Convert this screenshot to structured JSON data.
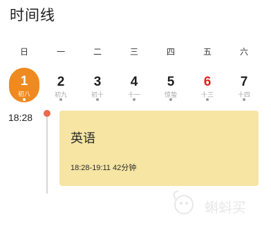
{
  "header": {
    "title": "时间线"
  },
  "weekdays": [
    "日",
    "一",
    "二",
    "三",
    "四",
    "五",
    "六"
  ],
  "days": [
    {
      "num": "1",
      "lunar": "初八",
      "selected": true,
      "red": false
    },
    {
      "num": "2",
      "lunar": "初九",
      "selected": false,
      "red": false
    },
    {
      "num": "3",
      "lunar": "初十",
      "selected": false,
      "red": false
    },
    {
      "num": "4",
      "lunar": "十一",
      "selected": false,
      "red": false
    },
    {
      "num": "5",
      "lunar": "惊蛰",
      "selected": false,
      "red": false
    },
    {
      "num": "6",
      "lunar": "十三",
      "selected": false,
      "red": true
    },
    {
      "num": "7",
      "lunar": "十四",
      "selected": false,
      "red": false
    }
  ],
  "timeline": {
    "time": "18:28",
    "event": {
      "title": "英语",
      "time_range": "18:28-19:11 42分钟"
    }
  },
  "watermark": {
    "text": "蝌蚪买"
  },
  "colors": {
    "accent": "#ee8a20",
    "holiday_red": "#e02222",
    "card_bg": "#f6e5a3",
    "timeline_dot": "#ec6b4e"
  }
}
